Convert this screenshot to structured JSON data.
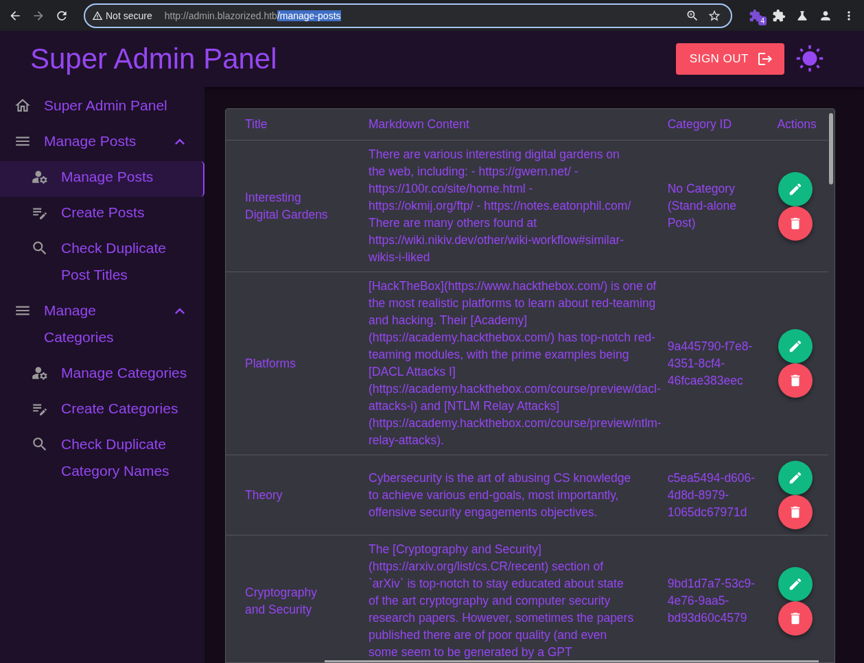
{
  "browser": {
    "security": "Not secure",
    "url_host": "http://admin.blazorized.htb",
    "url_path": "/manage-posts",
    "extension_badge": "4"
  },
  "header": {
    "title": "Super Admin Panel",
    "sign_out": "SIGN OUT"
  },
  "sidebar": {
    "items": [
      {
        "kind": "home",
        "label": "Super Admin Panel",
        "selected": false
      },
      {
        "kind": "group",
        "label": "Manage Posts",
        "expanded": true,
        "children": [
          {
            "kind": "manage",
            "label": "Manage Posts",
            "selected": true
          },
          {
            "kind": "create",
            "label": "Create Posts",
            "selected": false
          },
          {
            "kind": "check",
            "label": "Check Duplicate Post Titles",
            "selected": false
          }
        ]
      },
      {
        "kind": "group",
        "label": "Manage Categories",
        "expanded": true,
        "children": [
          {
            "kind": "manage",
            "label": "Manage Categories",
            "selected": false
          },
          {
            "kind": "create",
            "label": "Create Categories",
            "selected": false
          },
          {
            "kind": "check",
            "label": "Check Duplicate Category Names",
            "selected": false
          }
        ]
      }
    ]
  },
  "table": {
    "columns": [
      "Title",
      "Markdown Content",
      "Category ID",
      "Actions"
    ],
    "rows": [
      {
        "title": "Interesting Digital Gardens",
        "content": "There are various interesting digital gardens on the web, including: - https://gwern.net/ - https://100r.co/site/home.html - https://okmij.org/ftp/ - https://notes.eatonphil.com/ There are many others found at https://wiki.nikiv.dev/other/wiki-workflow#similar-wikis-i-liked",
        "category": "No Category (Stand-alone Post)"
      },
      {
        "title": "Platforms",
        "content": "[HackTheBox](https://www.hackthebox.com/) is one of the most realistic platforms to learn about red-teaming and hacking. Their [Academy](https://academy.hackthebox.com/) has top-notch red-teaming modules, with the prime examples being [DACL Attacks I](https://academy.hackthebox.com/course/preview/dacl-attacks-i) and [NTLM Relay Attacks](https://academy.hackthebox.com/course/preview/ntlm-relay-attacks).",
        "category": "9a445790-f7e8-4351-8cf4-46fcae383eec"
      },
      {
        "title": "Theory",
        "content": "Cybersecurity is the art of abusing CS knowledge to achieve various end-goals, most importantly, offensive security engagements objectives.",
        "category": "c5ea5494-d606-4d8d-8979-1065dc67971d"
      },
      {
        "title": "Cryptography and Security",
        "content": "The [Cryptography and Security](https://arxiv.org/list/cs.CR/recent) section of `arXiv` is top-notch to stay educated about state of the art cryptography and computer security research papers. However, sometimes the papers published there are of poor quality (and even some seem to be generated by a GPT",
        "category": "9bd1d7a7-53c9-4e76-9aa5-bd93d60c4579"
      }
    ]
  }
}
